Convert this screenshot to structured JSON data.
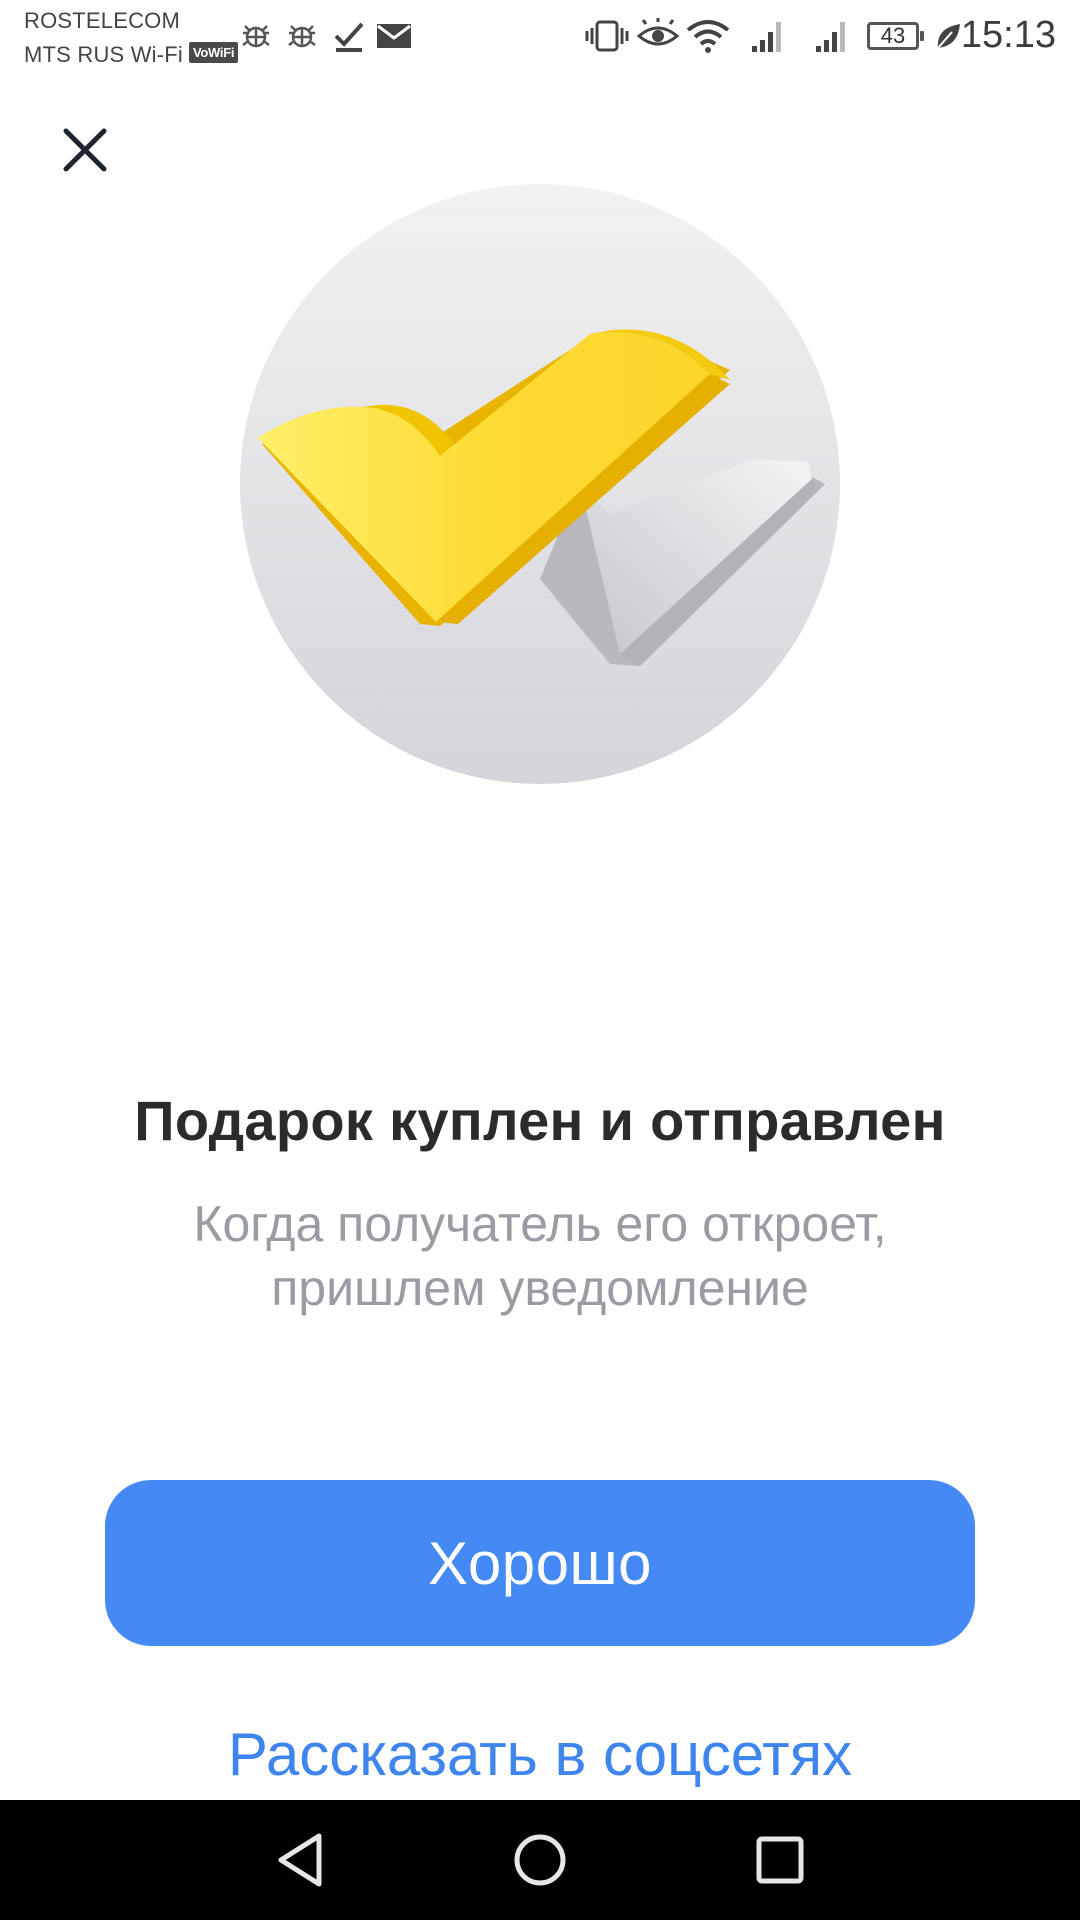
{
  "status_bar": {
    "carrier_primary": "ROSTELECOM",
    "carrier_secondary": "MTS RUS Wi-Fi",
    "vowifi_badge": "VoWiFi",
    "battery_level": "43",
    "time": "15:13",
    "icons": [
      "android-debug-icon",
      "android-debug-icon",
      "check-download-icon",
      "mail-icon",
      "vibrate-icon",
      "eye-comfort-icon",
      "wifi-icon",
      "signal-icon",
      "signal-icon",
      "battery-icon",
      "leaf-icon"
    ]
  },
  "close": {
    "icon": "close-icon"
  },
  "illustration": {
    "icon": "double-checkmark-illustration",
    "colors": {
      "circle_top": "#f1f1f3",
      "circle_bottom": "#d6d5da",
      "yellow_check": "#fdd835",
      "yellow_shade": "#e8b400",
      "grey_check": "#dcdce0"
    }
  },
  "message": {
    "title": "Подарок куплен и отправлен",
    "subtitle_line1": "Когда получатель его откроет,",
    "subtitle_line2": "пришлем уведомление"
  },
  "actions": {
    "primary_label": "Хорошо",
    "secondary_label": "Рассказать в соцсетях",
    "accent_color": "#4589f4"
  },
  "nav_bar": {
    "icons": [
      "back-icon",
      "home-icon",
      "recents-icon"
    ]
  }
}
